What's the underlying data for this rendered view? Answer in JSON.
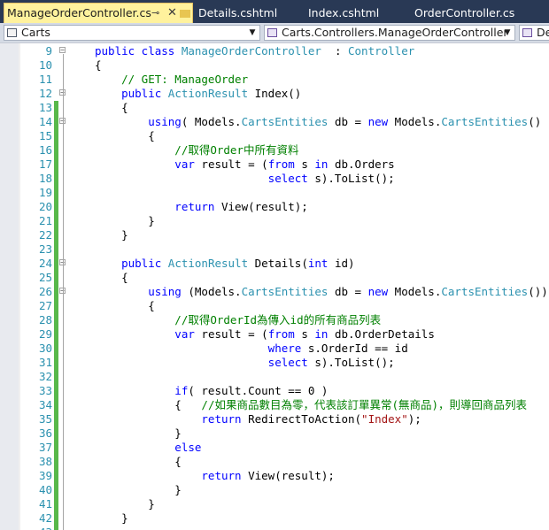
{
  "tabs": [
    {
      "label": "ManageOrderController.cs",
      "active": true
    },
    {
      "label": "Details.cshtml"
    },
    {
      "label": "Index.cshtml"
    },
    {
      "label": "OrderController.cs"
    }
  ],
  "tab_icons": {
    "pin": "⊸",
    "close": "✕"
  },
  "navbar": {
    "project": "Carts",
    "type": "Carts.Controllers.ManageOrderController",
    "member": "De"
  },
  "colors": {
    "tab_strip": "#293955",
    "active_tab": "#fff29d",
    "keyword": "#0000ff",
    "type": "#2b91af",
    "comment": "#008000",
    "string": "#a31515",
    "change_bar": "#58b84a"
  },
  "lines": [
    {
      "n": "9",
      "t": [
        [
          "kw",
          "public class "
        ],
        [
          "ty",
          "ManageOrderController"
        ],
        [
          "",
          "  : "
        ],
        [
          "ty",
          "Controller"
        ]
      ]
    },
    {
      "n": "10",
      "t": [
        [
          "",
          "{"
        ]
      ]
    },
    {
      "n": "11",
      "t": [
        [
          "cm",
          "    // GET: ManageOrder"
        ]
      ]
    },
    {
      "n": "12",
      "t": [
        [
          "kw",
          "    public "
        ],
        [
          "ty",
          "ActionResult"
        ],
        [
          "",
          " Index()"
        ]
      ]
    },
    {
      "n": "13",
      "t": [
        [
          "",
          "    {"
        ]
      ]
    },
    {
      "n": "14",
      "t": [
        [
          "kw",
          "        using"
        ],
        [
          "",
          "( Models."
        ],
        [
          "ty",
          "CartsEntities"
        ],
        [
          "",
          " db = "
        ],
        [
          "kw",
          "new"
        ],
        [
          "",
          " Models."
        ],
        [
          "ty",
          "CartsEntities"
        ],
        [
          "",
          "() )"
        ]
      ]
    },
    {
      "n": "15",
      "t": [
        [
          "",
          "        {"
        ]
      ]
    },
    {
      "n": "16",
      "t": [
        [
          "cm",
          "            //取得Order中所有資料"
        ]
      ]
    },
    {
      "n": "17",
      "t": [
        [
          "kw",
          "            var"
        ],
        [
          "",
          " result = ("
        ],
        [
          "kw",
          "from"
        ],
        [
          "",
          " s "
        ],
        [
          "kw",
          "in"
        ],
        [
          "",
          " db.Orders"
        ]
      ]
    },
    {
      "n": "18",
      "t": [
        [
          "",
          "                          "
        ],
        [
          "kw",
          "select"
        ],
        [
          "",
          " s).ToList();"
        ]
      ]
    },
    {
      "n": "19",
      "t": [
        [
          "",
          ""
        ]
      ]
    },
    {
      "n": "20",
      "t": [
        [
          "kw",
          "            return"
        ],
        [
          "",
          " View(result);"
        ]
      ]
    },
    {
      "n": "21",
      "t": [
        [
          "",
          "        }"
        ]
      ]
    },
    {
      "n": "22",
      "t": [
        [
          "",
          "    }"
        ]
      ]
    },
    {
      "n": "23",
      "t": [
        [
          "",
          ""
        ]
      ]
    },
    {
      "n": "24",
      "t": [
        [
          "kw",
          "    public "
        ],
        [
          "ty",
          "ActionResult"
        ],
        [
          "",
          " Details("
        ],
        [
          "kw",
          "int"
        ],
        [
          "",
          " id)"
        ]
      ]
    },
    {
      "n": "25",
      "t": [
        [
          "",
          "    {"
        ]
      ]
    },
    {
      "n": "26",
      "t": [
        [
          "kw",
          "        using"
        ],
        [
          "",
          " (Models."
        ],
        [
          "ty",
          "CartsEntities"
        ],
        [
          "",
          " db = "
        ],
        [
          "kw",
          "new"
        ],
        [
          "",
          " Models."
        ],
        [
          "ty",
          "CartsEntities"
        ],
        [
          "",
          "())"
        ]
      ]
    },
    {
      "n": "27",
      "t": [
        [
          "",
          "        {"
        ]
      ]
    },
    {
      "n": "28",
      "t": [
        [
          "cm",
          "            //取得OrderId為傳入id的所有商品列表"
        ]
      ]
    },
    {
      "n": "29",
      "t": [
        [
          "kw",
          "            var"
        ],
        [
          "",
          " result = ("
        ],
        [
          "kw",
          "from"
        ],
        [
          "",
          " s "
        ],
        [
          "kw",
          "in"
        ],
        [
          "",
          " db.OrderDetails"
        ]
      ]
    },
    {
      "n": "30",
      "t": [
        [
          "",
          "                          "
        ],
        [
          "kw",
          "where"
        ],
        [
          "",
          " s.OrderId == id"
        ]
      ]
    },
    {
      "n": "31",
      "t": [
        [
          "",
          "                          "
        ],
        [
          "kw",
          "select"
        ],
        [
          "",
          " s).ToList();"
        ]
      ]
    },
    {
      "n": "32",
      "t": [
        [
          "",
          ""
        ]
      ]
    },
    {
      "n": "33",
      "t": [
        [
          "kw",
          "            if"
        ],
        [
          "",
          "( result.Count == 0 )"
        ]
      ]
    },
    {
      "n": "34",
      "t": [
        [
          "",
          "            {   "
        ],
        [
          "cm",
          "//如果商品數目為零，代表該訂單異常(無商品)，則導回商品列表"
        ]
      ]
    },
    {
      "n": "35",
      "t": [
        [
          "kw",
          "                return"
        ],
        [
          "",
          " RedirectToAction("
        ],
        [
          "st",
          "\"Index\""
        ],
        [
          "",
          ");"
        ]
      ]
    },
    {
      "n": "36",
      "t": [
        [
          "",
          "            }"
        ]
      ]
    },
    {
      "n": "37",
      "t": [
        [
          "kw",
          "            else"
        ]
      ]
    },
    {
      "n": "38",
      "t": [
        [
          "",
          "            {"
        ]
      ]
    },
    {
      "n": "39",
      "t": [
        [
          "kw",
          "                return"
        ],
        [
          "",
          " View(result);"
        ]
      ]
    },
    {
      "n": "40",
      "t": [
        [
          "",
          "            }"
        ]
      ]
    },
    {
      "n": "41",
      "t": [
        [
          "",
          "        }"
        ]
      ]
    },
    {
      "n": "42",
      "t": [
        [
          "",
          "    }"
        ]
      ]
    },
    {
      "n": "43",
      "t": [
        [
          "",
          ""
        ]
      ]
    }
  ]
}
